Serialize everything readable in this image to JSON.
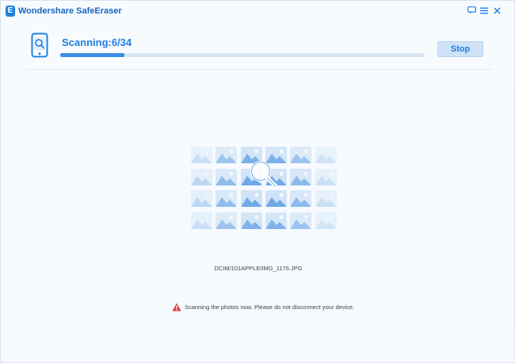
{
  "app": {
    "title": "Wondershare SafeEraser",
    "logo_letter": "E"
  },
  "window_controls": [
    {
      "name": "feedback-icon"
    },
    {
      "name": "menu-icon"
    },
    {
      "name": "close-icon"
    }
  ],
  "scan": {
    "title": "Scanning:6/34",
    "current": 6,
    "total": 34,
    "progress_fraction": 0.1765,
    "stop_label": "Stop",
    "current_file": "DCIM/101APPLE/IMG_1176.JPG",
    "warning": "Scanning the photos now. Please do not disconnect your device."
  },
  "colors": {
    "accent": "#1f7fe0",
    "progress": "#3a8ee6",
    "warning": "#e0393e"
  },
  "photo_grid": {
    "rows": 4,
    "cols": 6,
    "intensity": [
      [
        0.25,
        0.6,
        0.9,
        0.9,
        0.6,
        0.2
      ],
      [
        0.35,
        0.7,
        1.0,
        1.0,
        0.75,
        0.25
      ],
      [
        0.35,
        0.7,
        1.0,
        1.0,
        0.75,
        0.25
      ],
      [
        0.25,
        0.6,
        0.85,
        0.85,
        0.6,
        0.2
      ]
    ]
  }
}
